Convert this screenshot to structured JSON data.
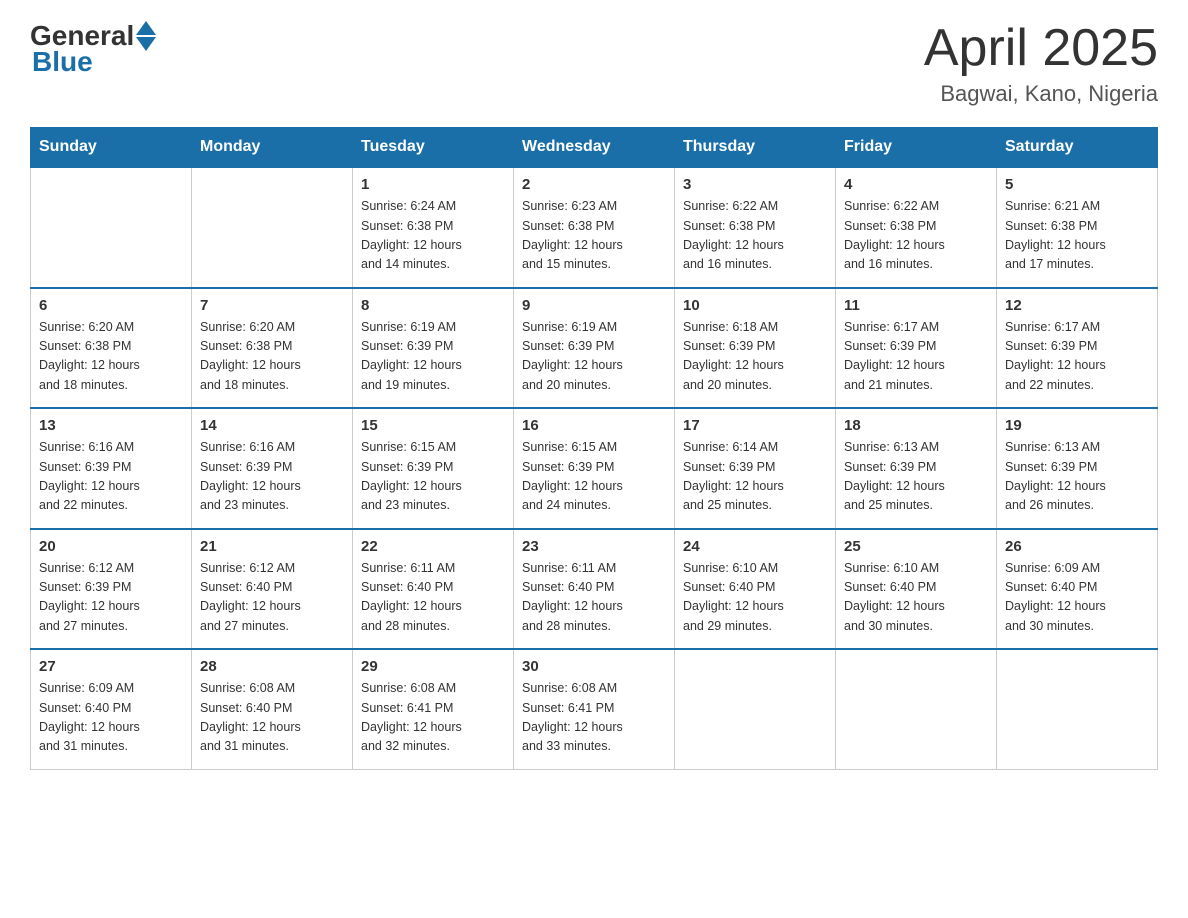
{
  "header": {
    "logo_general": "General",
    "logo_blue": "Blue",
    "title": "April 2025",
    "location": "Bagwai, Kano, Nigeria"
  },
  "weekdays": [
    "Sunday",
    "Monday",
    "Tuesday",
    "Wednesday",
    "Thursday",
    "Friday",
    "Saturday"
  ],
  "weeks": [
    [
      {
        "day": "",
        "info": ""
      },
      {
        "day": "",
        "info": ""
      },
      {
        "day": "1",
        "info": "Sunrise: 6:24 AM\nSunset: 6:38 PM\nDaylight: 12 hours\nand 14 minutes."
      },
      {
        "day": "2",
        "info": "Sunrise: 6:23 AM\nSunset: 6:38 PM\nDaylight: 12 hours\nand 15 minutes."
      },
      {
        "day": "3",
        "info": "Sunrise: 6:22 AM\nSunset: 6:38 PM\nDaylight: 12 hours\nand 16 minutes."
      },
      {
        "day": "4",
        "info": "Sunrise: 6:22 AM\nSunset: 6:38 PM\nDaylight: 12 hours\nand 16 minutes."
      },
      {
        "day": "5",
        "info": "Sunrise: 6:21 AM\nSunset: 6:38 PM\nDaylight: 12 hours\nand 17 minutes."
      }
    ],
    [
      {
        "day": "6",
        "info": "Sunrise: 6:20 AM\nSunset: 6:38 PM\nDaylight: 12 hours\nand 18 minutes."
      },
      {
        "day": "7",
        "info": "Sunrise: 6:20 AM\nSunset: 6:38 PM\nDaylight: 12 hours\nand 18 minutes."
      },
      {
        "day": "8",
        "info": "Sunrise: 6:19 AM\nSunset: 6:39 PM\nDaylight: 12 hours\nand 19 minutes."
      },
      {
        "day": "9",
        "info": "Sunrise: 6:19 AM\nSunset: 6:39 PM\nDaylight: 12 hours\nand 20 minutes."
      },
      {
        "day": "10",
        "info": "Sunrise: 6:18 AM\nSunset: 6:39 PM\nDaylight: 12 hours\nand 20 minutes."
      },
      {
        "day": "11",
        "info": "Sunrise: 6:17 AM\nSunset: 6:39 PM\nDaylight: 12 hours\nand 21 minutes."
      },
      {
        "day": "12",
        "info": "Sunrise: 6:17 AM\nSunset: 6:39 PM\nDaylight: 12 hours\nand 22 minutes."
      }
    ],
    [
      {
        "day": "13",
        "info": "Sunrise: 6:16 AM\nSunset: 6:39 PM\nDaylight: 12 hours\nand 22 minutes."
      },
      {
        "day": "14",
        "info": "Sunrise: 6:16 AM\nSunset: 6:39 PM\nDaylight: 12 hours\nand 23 minutes."
      },
      {
        "day": "15",
        "info": "Sunrise: 6:15 AM\nSunset: 6:39 PM\nDaylight: 12 hours\nand 23 minutes."
      },
      {
        "day": "16",
        "info": "Sunrise: 6:15 AM\nSunset: 6:39 PM\nDaylight: 12 hours\nand 24 minutes."
      },
      {
        "day": "17",
        "info": "Sunrise: 6:14 AM\nSunset: 6:39 PM\nDaylight: 12 hours\nand 25 minutes."
      },
      {
        "day": "18",
        "info": "Sunrise: 6:13 AM\nSunset: 6:39 PM\nDaylight: 12 hours\nand 25 minutes."
      },
      {
        "day": "19",
        "info": "Sunrise: 6:13 AM\nSunset: 6:39 PM\nDaylight: 12 hours\nand 26 minutes."
      }
    ],
    [
      {
        "day": "20",
        "info": "Sunrise: 6:12 AM\nSunset: 6:39 PM\nDaylight: 12 hours\nand 27 minutes."
      },
      {
        "day": "21",
        "info": "Sunrise: 6:12 AM\nSunset: 6:40 PM\nDaylight: 12 hours\nand 27 minutes."
      },
      {
        "day": "22",
        "info": "Sunrise: 6:11 AM\nSunset: 6:40 PM\nDaylight: 12 hours\nand 28 minutes."
      },
      {
        "day": "23",
        "info": "Sunrise: 6:11 AM\nSunset: 6:40 PM\nDaylight: 12 hours\nand 28 minutes."
      },
      {
        "day": "24",
        "info": "Sunrise: 6:10 AM\nSunset: 6:40 PM\nDaylight: 12 hours\nand 29 minutes."
      },
      {
        "day": "25",
        "info": "Sunrise: 6:10 AM\nSunset: 6:40 PM\nDaylight: 12 hours\nand 30 minutes."
      },
      {
        "day": "26",
        "info": "Sunrise: 6:09 AM\nSunset: 6:40 PM\nDaylight: 12 hours\nand 30 minutes."
      }
    ],
    [
      {
        "day": "27",
        "info": "Sunrise: 6:09 AM\nSunset: 6:40 PM\nDaylight: 12 hours\nand 31 minutes."
      },
      {
        "day": "28",
        "info": "Sunrise: 6:08 AM\nSunset: 6:40 PM\nDaylight: 12 hours\nand 31 minutes."
      },
      {
        "day": "29",
        "info": "Sunrise: 6:08 AM\nSunset: 6:41 PM\nDaylight: 12 hours\nand 32 minutes."
      },
      {
        "day": "30",
        "info": "Sunrise: 6:08 AM\nSunset: 6:41 PM\nDaylight: 12 hours\nand 33 minutes."
      },
      {
        "day": "",
        "info": ""
      },
      {
        "day": "",
        "info": ""
      },
      {
        "day": "",
        "info": ""
      }
    ]
  ]
}
